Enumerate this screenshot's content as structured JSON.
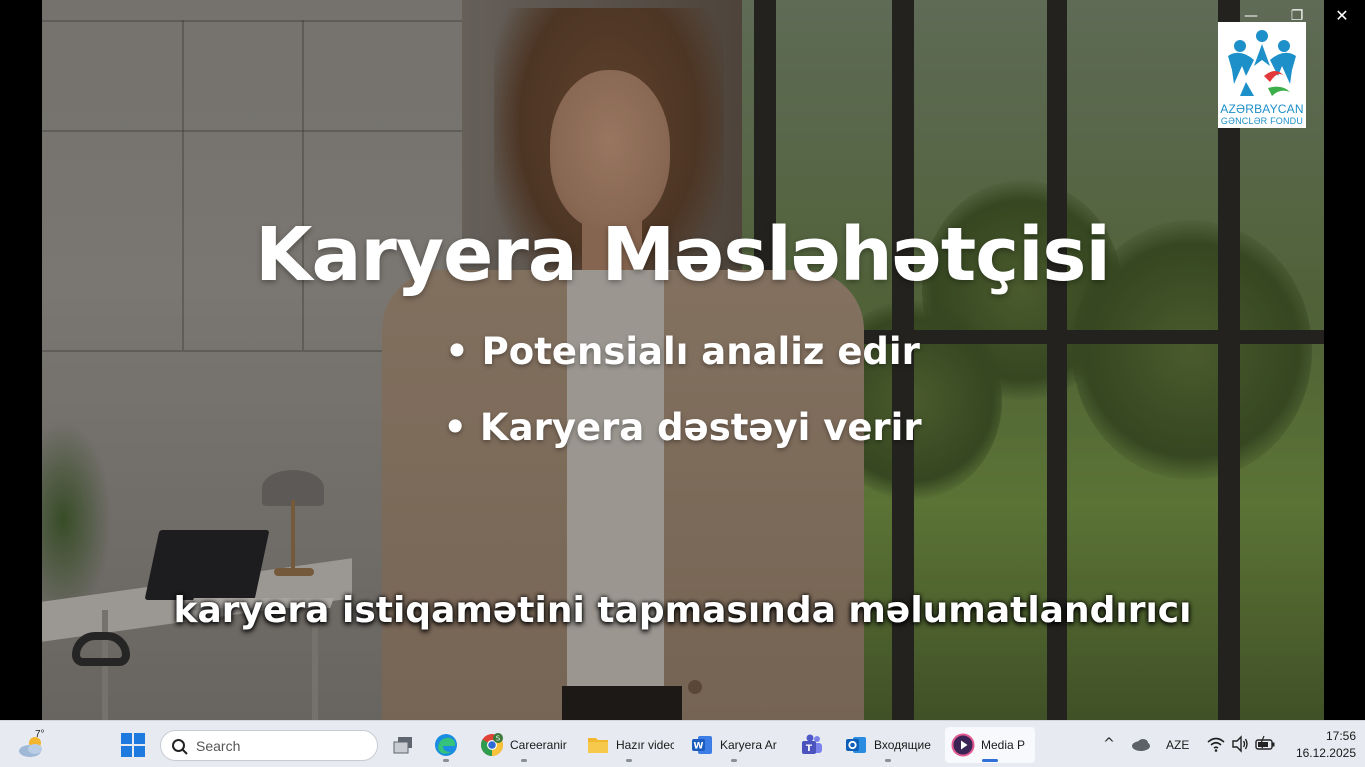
{
  "window": {
    "minimize_icon": "minimize-icon",
    "maximize_icon": "restore-icon",
    "close_icon": "close-icon",
    "minimize_glyph": "—",
    "restore_glyph": "❐",
    "close_glyph": "✕"
  },
  "video": {
    "title": "Karyera Məsləhətçisi",
    "bullets": [
      "• Potensialı analiz edir",
      "• Karyera dəstəyi verir"
    ],
    "subtitle": "karyera istiqamətini tapmasında məlumatlandırıcı"
  },
  "logo": {
    "line1": "AZƏRBAYCAN",
    "line2": "GƏNCLƏR FONDU",
    "colors": [
      "#1d8fc9",
      "#e23a3a",
      "#3cae4a"
    ]
  },
  "taskbar": {
    "weather": {
      "temp": "7°",
      "icon": "partly-cloudy-icon"
    },
    "search": {
      "placeholder": "Search"
    },
    "apps": [
      {
        "name": "task-view",
        "label": ""
      },
      {
        "name": "edge",
        "label": ""
      },
      {
        "name": "chrome",
        "label": "Careeranir",
        "badge": "S"
      },
      {
        "name": "file-explorer",
        "label": "Hazır videc"
      },
      {
        "name": "word",
        "label": "Karyera Ar"
      },
      {
        "name": "teams",
        "label": ""
      },
      {
        "name": "outlook",
        "label": "Входящие"
      },
      {
        "name": "media-player",
        "label": "Media P"
      }
    ],
    "tray": {
      "chevron": "^",
      "language": "AZE"
    },
    "clock": {
      "time": "17:56",
      "date": "16.12.2025"
    }
  },
  "colors": {
    "taskbar_bg": "#e7ebf1",
    "accent": "#2f6fd6",
    "text_overlay": "#ffffff"
  }
}
